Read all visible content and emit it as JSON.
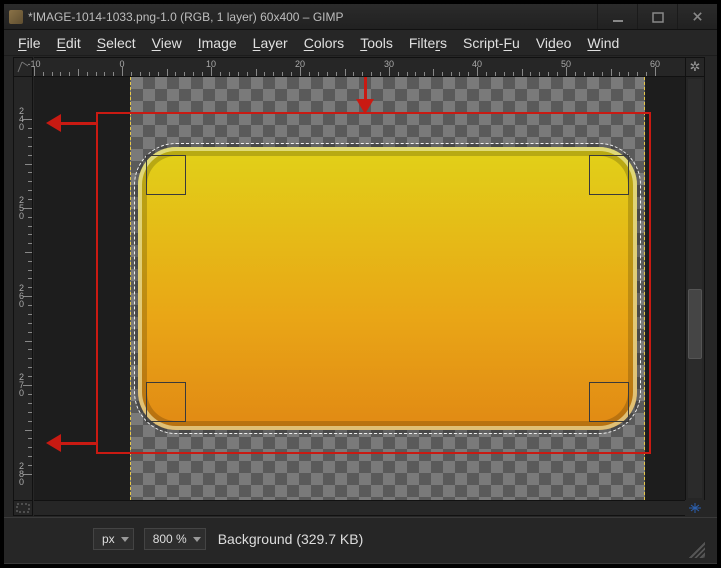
{
  "title": "*IMAGE-1014-1033.png-1.0 (RGB, 1 layer) 60x400 – GIMP",
  "menus": [
    {
      "u": "F",
      "rest": "ile"
    },
    {
      "u": "E",
      "rest": "dit"
    },
    {
      "u": "S",
      "rest": "elect"
    },
    {
      "u": "V",
      "rest": "iew"
    },
    {
      "u": "I",
      "rest": "mage"
    },
    {
      "u": "L",
      "rest": "ayer"
    },
    {
      "u": "C",
      "rest": "olors"
    },
    {
      "u": "T",
      "rest": "ools"
    },
    {
      "u": "",
      "rest": "Filte",
      "u2": "r",
      "rest2": "s"
    },
    {
      "u": "",
      "rest": "Script-",
      "u2": "F",
      "rest2": "u"
    },
    {
      "u": "",
      "rest": "Vi",
      "u2": "d",
      "rest2": "eo"
    },
    {
      "u": "W",
      "rest": "ind"
    }
  ],
  "ruler_h": [
    {
      "px": 0,
      "label": "-10"
    },
    {
      "px": 88,
      "label": "0"
    },
    {
      "px": 177,
      "label": "10"
    },
    {
      "px": 266,
      "label": "20"
    },
    {
      "px": 355,
      "label": "30"
    },
    {
      "px": 443,
      "label": "40"
    },
    {
      "px": 532,
      "label": "50"
    },
    {
      "px": 621,
      "label": "60"
    }
  ],
  "ruler_v": [
    {
      "px": 42,
      "label": "240"
    },
    {
      "px": 131,
      "label": "250"
    },
    {
      "px": 219,
      "label": "260"
    },
    {
      "px": 308,
      "label": "270"
    },
    {
      "px": 397,
      "label": "280"
    }
  ],
  "status": {
    "unit": "px",
    "zoom": "800 %",
    "label": "Background (329.7 KB)"
  }
}
